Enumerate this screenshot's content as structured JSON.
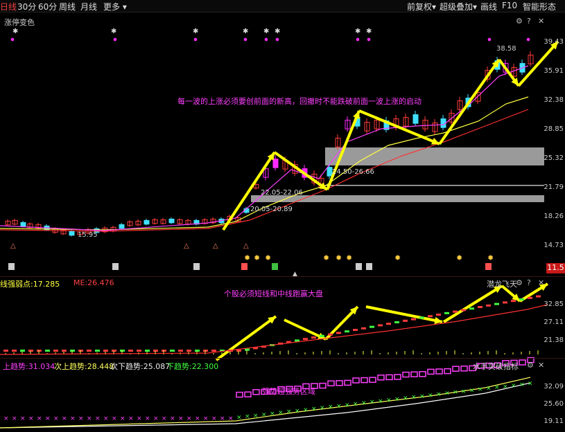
{
  "toolbar": {
    "items": [
      "日线",
      "30分",
      "60分",
      "周线",
      "月线",
      "更多 ▾"
    ],
    "right": [
      "前复权▾",
      "超级叠加▾",
      "画线",
      "F10",
      "智能形态"
    ]
  },
  "main": {
    "indicator_name": "涨停变色",
    "annotation": "每一波的上涨必须要创前面的新高，回撤时不能跌破前面一波上涨的启动",
    "zone_upper_label": "24.50-26.66",
    "zone_mid_label": "22.05-22.06",
    "zone_lower_label": "20.05-20.89",
    "low_label": "15.95",
    "high_label": "38.58",
    "y_labels": [
      "39.43",
      "35.91",
      "32.38",
      "28.85",
      "25.32",
      "21.79",
      "18.26",
      "14.73"
    ],
    "price_badge": "11.5"
  },
  "sub1": {
    "indicator_label": "线强弱点:17.285",
    "me_label": "ME:26.476",
    "title": "潜龙飞天",
    "annotation": "个股必须短线和中线跑赢大盘",
    "y_labels": [
      "32.85",
      "27.11",
      "21.38"
    ]
  },
  "sub2": {
    "up_trend": "上趋势:31.034",
    "next_up_trend": "次上趋势:28.448",
    "next_down_trend": "次下趋势:25.087",
    "down_trend": "下趋势:22.300",
    "title": "水手突破指标",
    "annotation": "强势超强势区域",
    "y_labels": [
      "32.09",
      "25.60",
      "19.11"
    ]
  },
  "icons": [
    "settings-icon",
    "help-icon",
    "close-icon"
  ],
  "colors": {
    "up": "#ff3c3c",
    "down": "#40e0ff",
    "limit_up": "#ff2aff",
    "ma_short": "#ff40ff",
    "ma_mid": "#ffff40",
    "ma_long": "#ff3030",
    "annotation": "#ff40ff",
    "arrow": "#ffff00",
    "zone": "#9a9a9a"
  }
}
